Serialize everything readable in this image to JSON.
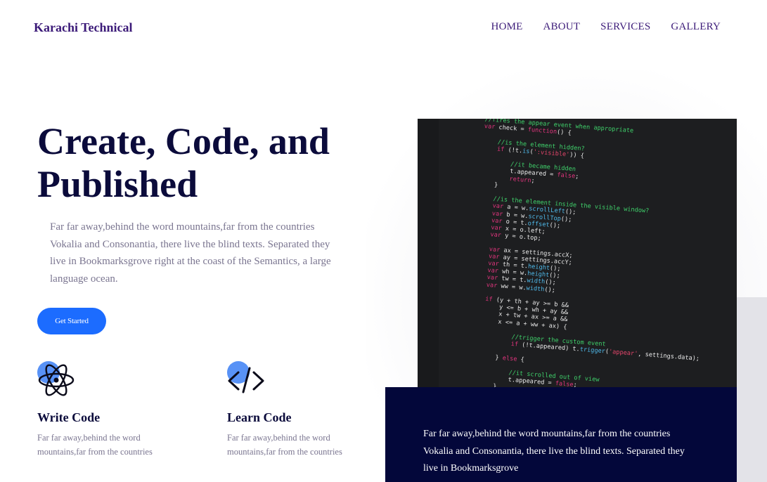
{
  "brand": "Karachi Technical",
  "nav": [
    "HOME",
    "ABOUT",
    "SERVICES",
    "GALLERY"
  ],
  "hero": {
    "title": "Create, Code, and Published",
    "text": "Far far away,behind the word mountains,far from the countries Vokalia and Consonantia, there live the blind texts. Separated they live in Bookmarksgrove right at the coast of the Semantics, a large language ocean.",
    "cta": "Get Started"
  },
  "features": [
    {
      "icon": "atom-icon",
      "title": "Write Code",
      "text": "Far far away,behind the word mountains,far from the countries"
    },
    {
      "icon": "code-icon",
      "title": "Learn Code",
      "text": "Far far away,behind the word mountains,far from the countries"
    }
  ],
  "code_image": {
    "lines": [
      "//fires the appear event when appropriate",
      "var check = function() {",
      "",
      "    //is the element hidden?",
      "    if (!t.is(':visible')) {",
      "",
      "        //it became hidden",
      "        t.appeared = false;",
      "        return;",
      "    }",
      "",
      "    //is the element inside the visible window?",
      "    var a = w.scrollLeft();",
      "    var b = w.scrollTop();",
      "    var o = t.offset();",
      "    var x = o.left;",
      "    var y = o.top;",
      "",
      "    var ax = settings.accX;",
      "    var ay = settings.accY;",
      "    var th = t.height();",
      "    var wh = w.height();",
      "    var tw = t.width();",
      "    var ww = w.width();",
      "",
      "    if (y + th + ay >= b &&",
      "        y <= b + wh + ay &&",
      "        x + tw + ax >= a &&",
      "        x <= a + ww + ax) {",
      "",
      "            //trigger the custom event",
      "            if (!t.appeared) t.trigger('appear', settings.data);",
      "",
      "        } else {",
      "",
      "            //it scrolled out of view",
      "            t.appeared = false;",
      "        }"
    ]
  },
  "info_box": {
    "text": "Far far away,behind the word mountains,far from the countries Vokalia and Consonantia, there live the blind texts. Separated they live in Bookmarksgrove"
  },
  "colors": {
    "brand": "#3b1a78",
    "heading": "#0b0b3b",
    "body_text": "#7a7590",
    "cta": "#1c6cff",
    "icon_dot": "#4f8cf5",
    "info_box_bg": "#03073a"
  }
}
